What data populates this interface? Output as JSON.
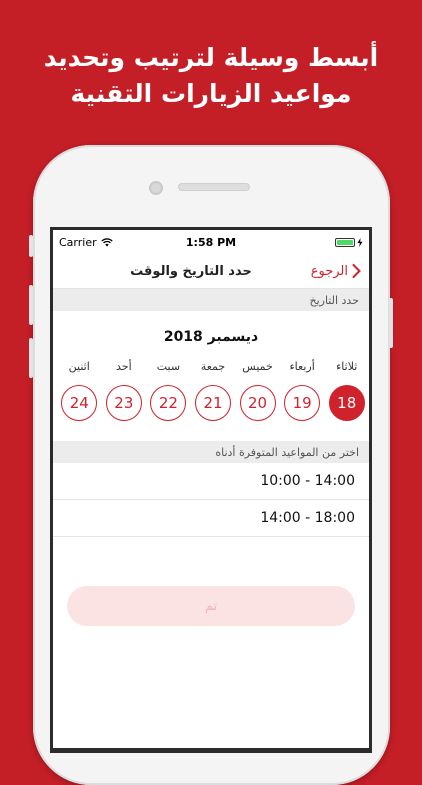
{
  "headline": {
    "line1": "أبسط وسيلة لترتيب وتحديد",
    "line2": "مواعيد الزيارات التقنية"
  },
  "status_bar": {
    "carrier": "Carrier",
    "time": "1:58 PM"
  },
  "nav": {
    "title": "حدد التاريخ والوقت",
    "back_label": "الرجوع"
  },
  "date_section": {
    "header": "حدد التاريخ",
    "month": "ديسمبر 2018"
  },
  "days": [
    {
      "name": "ثلاثاء",
      "number": "18",
      "selected": true
    },
    {
      "name": "أربعاء",
      "number": "19",
      "selected": false
    },
    {
      "name": "خميس",
      "number": "20",
      "selected": false
    },
    {
      "name": "جمعة",
      "number": "21",
      "selected": false
    },
    {
      "name": "سبت",
      "number": "22",
      "selected": false
    },
    {
      "name": "أحد",
      "number": "23",
      "selected": false
    },
    {
      "name": "اثنين",
      "number": "24",
      "selected": false
    }
  ],
  "time_section": {
    "header": "اختر من المواعيد المتوفرة أدناه",
    "slots": [
      "10:00 - 14:00",
      "14:00 - 18:00"
    ]
  },
  "done_button": {
    "label": "تم"
  },
  "colors": {
    "brand": "#c41e27",
    "accent": "#d0222c",
    "battery": "#4cd964"
  }
}
